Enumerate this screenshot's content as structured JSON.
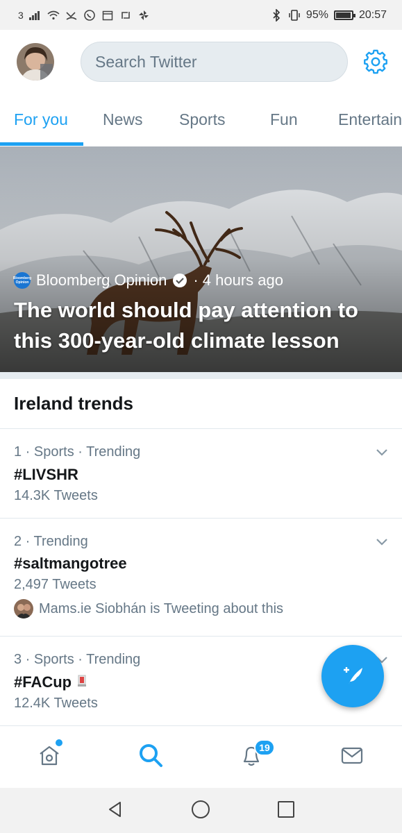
{
  "status_bar": {
    "carrier": "3",
    "bluetooth_icon": "bluetooth-icon",
    "battery_percent": "95%",
    "battery_level": 0.95,
    "time": "20:57"
  },
  "header": {
    "search_placeholder": "Search Twitter",
    "settings_icon": "gear-icon"
  },
  "tabs": [
    {
      "label": "For you",
      "active": true
    },
    {
      "label": "News",
      "active": false
    },
    {
      "label": "Sports",
      "active": false
    },
    {
      "label": "Fun",
      "active": false
    },
    {
      "label": "Entertain",
      "active": false
    }
  ],
  "hero": {
    "source": "Bloomberg Opinion",
    "logo_text": "Bloomberg Opinion",
    "time": "· 4 hours ago",
    "title": "The world should pay attention to this 300-year-old climate lesson"
  },
  "trends": {
    "title": "Ireland trends",
    "items": [
      {
        "meta": "1 · Sports · Trending",
        "tag": "#LIVSHR",
        "count": "14.3K Tweets"
      },
      {
        "meta": "2 · Trending",
        "tag": "#saltmangotree",
        "count": "2,497 Tweets",
        "about": "Mams.ie Siobhán is Tweeting about this"
      },
      {
        "meta": "3 · Sports · Trending",
        "tag": "#FACup",
        "count": "12.4K Tweets"
      }
    ]
  },
  "fab": {
    "icon": "compose-tweet-icon"
  },
  "bottom_nav": {
    "notifications_badge": "19",
    "items": [
      "home-icon",
      "search-icon",
      "notifications-icon",
      "messages-icon"
    ]
  },
  "colors": {
    "accent": "#1da1f2",
    "text_primary": "#14171a",
    "text_secondary": "#657786"
  }
}
